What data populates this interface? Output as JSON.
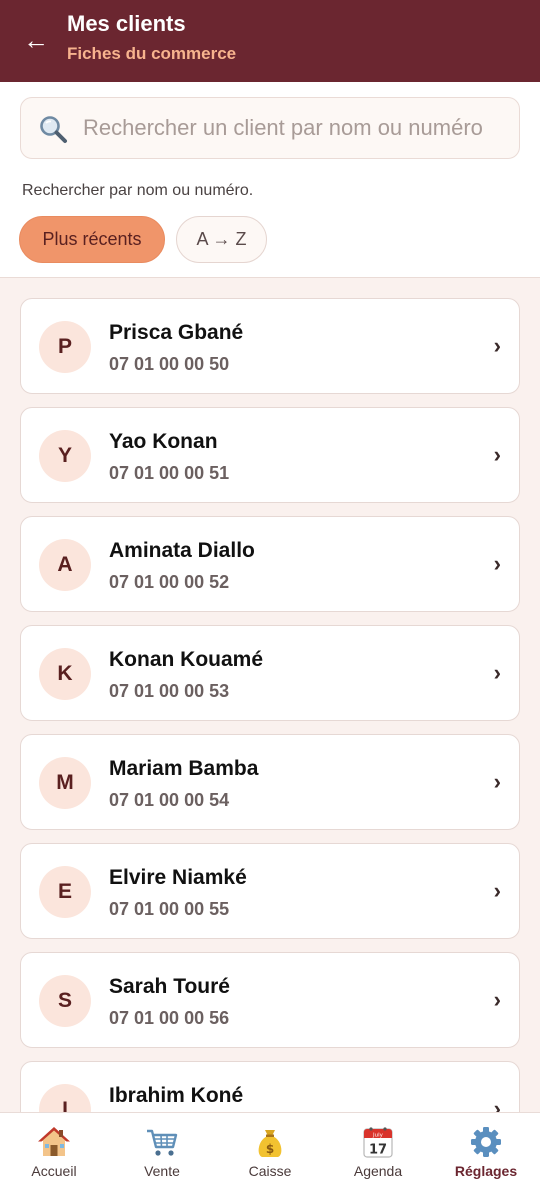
{
  "header": {
    "title": "Mes clients",
    "subtitle": "Fiches du commerce"
  },
  "search": {
    "placeholder": "Rechercher un client par nom ou numéro",
    "value": "",
    "hint": "Rechercher par nom ou numéro."
  },
  "sort": {
    "recent_label": "Plus récents",
    "az_label": "A → Z",
    "selected": "Plus récents"
  },
  "clients": [
    {
      "initial": "P",
      "name": "Prisca Gbané",
      "phone": "07 01 00 00 50"
    },
    {
      "initial": "Y",
      "name": "Yao Konan",
      "phone": "07 01 00 00 51"
    },
    {
      "initial": "A",
      "name": "Aminata Diallo",
      "phone": "07 01 00 00 52"
    },
    {
      "initial": "K",
      "name": "Konan Kouamé",
      "phone": "07 01 00 00 53"
    },
    {
      "initial": "M",
      "name": "Mariam Bamba",
      "phone": "07 01 00 00 54"
    },
    {
      "initial": "E",
      "name": "Elvire Niamké",
      "phone": "07 01 00 00 55"
    },
    {
      "initial": "S",
      "name": "Sarah Touré",
      "phone": "07 01 00 00 56"
    },
    {
      "initial": "I",
      "name": "Ibrahim Koné",
      "phone": ""
    }
  ],
  "nav": [
    {
      "label": "Accueil",
      "icon": "house-icon"
    },
    {
      "label": "Vente",
      "icon": "cart-icon"
    },
    {
      "label": "Caisse",
      "icon": "money-bag-icon"
    },
    {
      "label": "Agenda",
      "icon": "calendar-icon",
      "calendar_month": "July",
      "calendar_day": "17"
    },
    {
      "label": "Réglages",
      "icon": "gear-icon",
      "active": true
    }
  ],
  "colors": {
    "header_bg": "#6b2630",
    "accent": "#f0956a",
    "subtitle": "#f7b38e",
    "background": "#faf1ee"
  }
}
